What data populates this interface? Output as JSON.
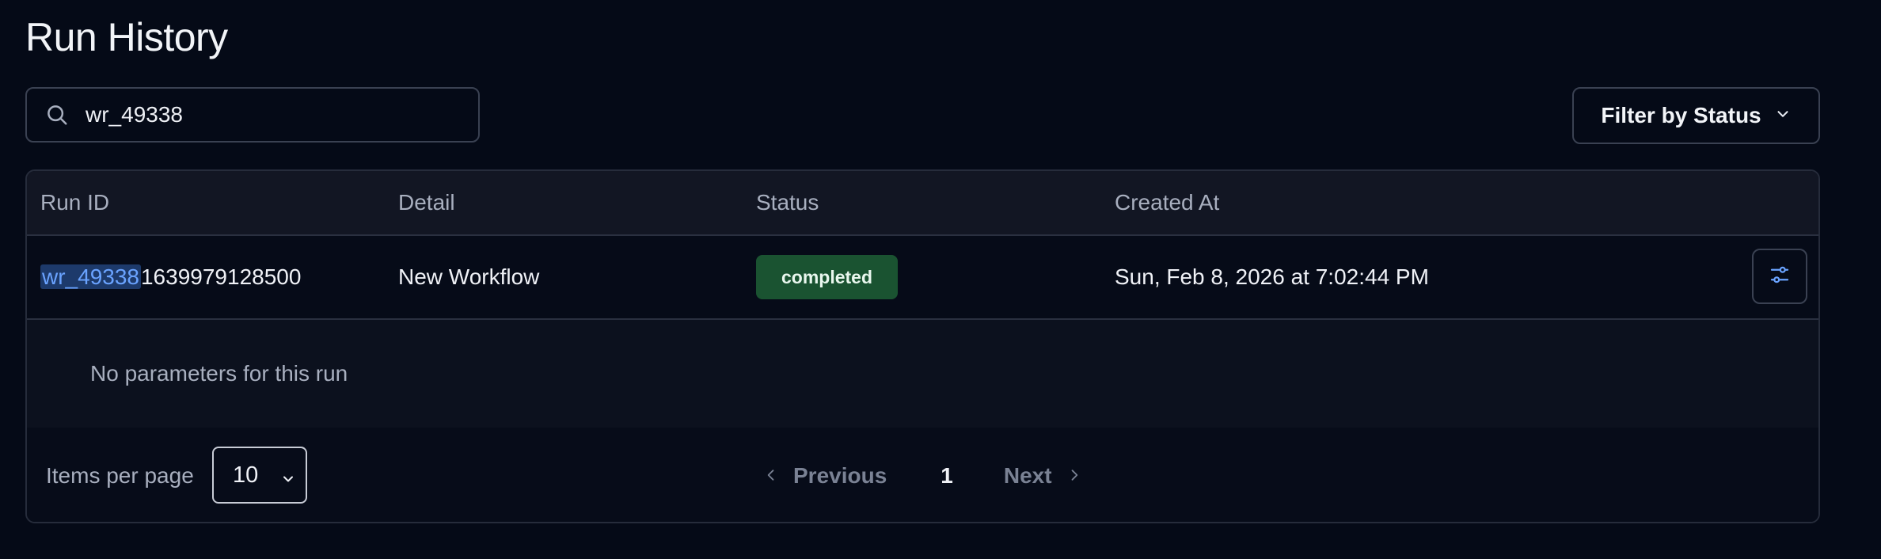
{
  "page": {
    "title": "Run History"
  },
  "search": {
    "value": "wr_49338",
    "icon": "search-icon"
  },
  "filter": {
    "label": "Filter by Status",
    "icon": "chevron-down-icon"
  },
  "table": {
    "columns": [
      "Run ID",
      "Detail",
      "Status",
      "Created At"
    ],
    "rows": [
      {
        "run_id_match": "wr_49338",
        "run_id_rest": "1639979128500",
        "detail": "New Workflow",
        "status": "completed",
        "created_at": "Sun, Feb 8, 2026 at 7:02:44 PM",
        "action_icon": "sliders-icon"
      }
    ],
    "expanded_message": "No parameters for this run"
  },
  "colors": {
    "background": "#050a17",
    "status_completed": "#1a5331",
    "highlight": "#1d3a6b",
    "highlight_text": "#6aa3ff",
    "accent_icon": "#6aa3ff"
  },
  "pagination": {
    "items_per_page_label": "Items per page",
    "items_per_page_value": "10",
    "previous_label": "Previous",
    "current_page": "1",
    "next_label": "Next"
  }
}
